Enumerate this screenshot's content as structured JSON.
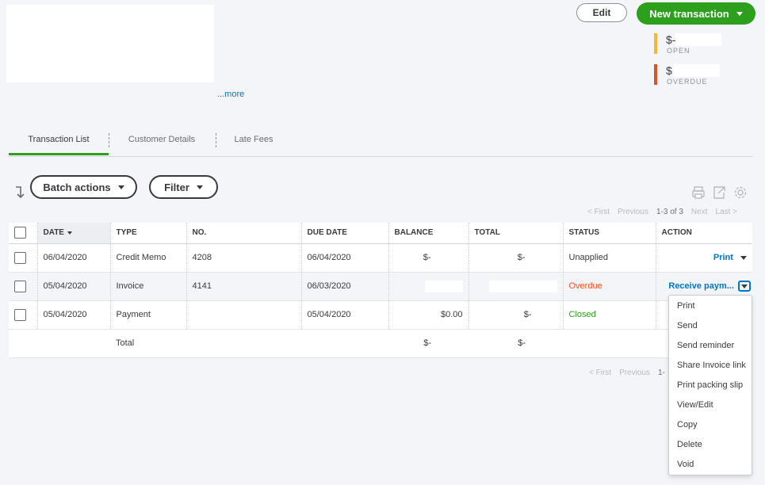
{
  "header": {
    "more_link": "...more",
    "edit_label": "Edit",
    "new_transaction_label": "New transaction",
    "open_amount": "$-",
    "open_label": "OPEN",
    "overdue_amount": "$",
    "overdue_label": "OVERDUE",
    "colors": {
      "open": "#f2b835",
      "overdue": "#d5542a",
      "primary": "#2ca01c",
      "link": "#0077c5"
    }
  },
  "tabs": [
    {
      "label": "Transaction List",
      "active": true
    },
    {
      "label": "Customer Details",
      "active": false
    },
    {
      "label": "Late Fees",
      "active": false
    }
  ],
  "toolbar": {
    "batch_actions_label": "Batch actions",
    "filter_label": "Filter",
    "icons": [
      "print-icon",
      "export-icon",
      "settings-icon"
    ]
  },
  "pager_top": {
    "first": "< First",
    "previous": "Previous",
    "range": "1-3 of 3",
    "next": "Next",
    "last": "Last >"
  },
  "pager_bottom": {
    "first": "< First",
    "previous": "Previous",
    "range": "1-"
  },
  "table": {
    "columns": [
      "DATE",
      "TYPE",
      "NO.",
      "DUE DATE",
      "BALANCE",
      "TOTAL",
      "STATUS",
      "ACTION"
    ],
    "rows": [
      {
        "date": "06/04/2020",
        "type": "Credit Memo",
        "no": "4208",
        "due_date": "06/04/2020",
        "balance": "$-",
        "total": "$-",
        "status": "Unapplied",
        "action": "Print"
      },
      {
        "date": "05/04/2020",
        "type": "Invoice",
        "no": "4141",
        "due_date": "06/03/2020",
        "balance": "",
        "total": "",
        "status": "Overdue",
        "action": "Receive paym..."
      },
      {
        "date": "05/04/2020",
        "type": "Payment",
        "no": "",
        "due_date": "05/04/2020",
        "balance": "$0.00",
        "total": "$-",
        "status": "Closed",
        "action": ""
      }
    ],
    "total_label": "Total",
    "total_balance": "$-",
    "total_total": "$-"
  },
  "action_menu": [
    "Print",
    "Send",
    "Send reminder",
    "Share Invoice link",
    "Print packing slip",
    "View/Edit",
    "Copy",
    "Delete",
    "Void"
  ]
}
